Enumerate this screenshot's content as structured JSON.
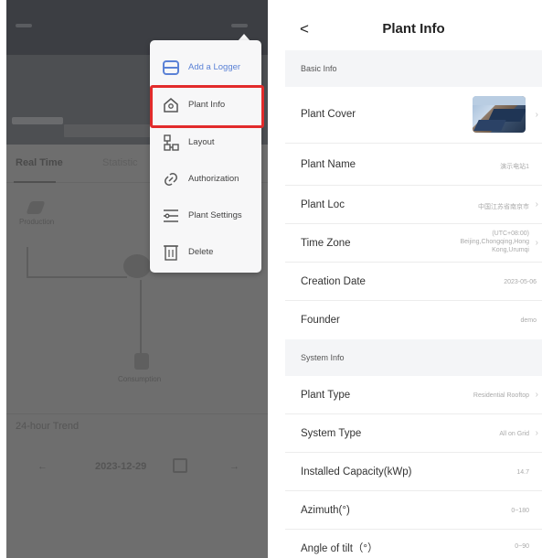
{
  "left_screen": {
    "tabs": [
      "Real Time",
      "Statistic"
    ],
    "labels": {
      "production": "Production",
      "consumption": "Consumption",
      "trend": "24-hour Trend",
      "date": "2023-12-29"
    },
    "menu": {
      "items": [
        {
          "label": "Add a Logger",
          "icon": "logger-icon"
        },
        {
          "label": "Plant Info",
          "icon": "home-info-icon"
        },
        {
          "label": "Layout",
          "icon": "layout-icon"
        },
        {
          "label": "Authorization",
          "icon": "link-icon"
        },
        {
          "label": "Plant Settings",
          "icon": "settings-list-icon"
        },
        {
          "label": "Delete",
          "icon": "trash-icon"
        }
      ],
      "highlighted": "Plant Info",
      "highlight_color": "#e22b2b",
      "accent_color": "#5b82d6"
    }
  },
  "right_screen": {
    "title": "Plant Info",
    "back_glyph": "<",
    "sections": [
      {
        "header": "Basic Info",
        "rows": [
          {
            "label": "Plant Cover",
            "value": ""
          },
          {
            "label": "Plant Name",
            "value": "演示电站1"
          },
          {
            "label": "Plant Loc",
            "value": "中国江苏省南京市"
          },
          {
            "label": "Time Zone",
            "value": "(UTC+08:00) Beijing,Chongqing,Hong Kong,Urumqi"
          },
          {
            "label": "Creation Date",
            "value": "2023-05-06"
          },
          {
            "label": "Founder",
            "value": "demo"
          }
        ]
      },
      {
        "header": "System Info",
        "rows": [
          {
            "label": "Plant Type",
            "value": "Residential Rooftop"
          },
          {
            "label": "System Type",
            "value": "All on Grid"
          },
          {
            "label": "Installed Capacity(kWp)",
            "value": "14.7"
          },
          {
            "label": "Azimuth(°)",
            "value": "0~180"
          },
          {
            "label": "Angle of tilt（°）",
            "value": "0~90"
          }
        ]
      }
    ]
  }
}
